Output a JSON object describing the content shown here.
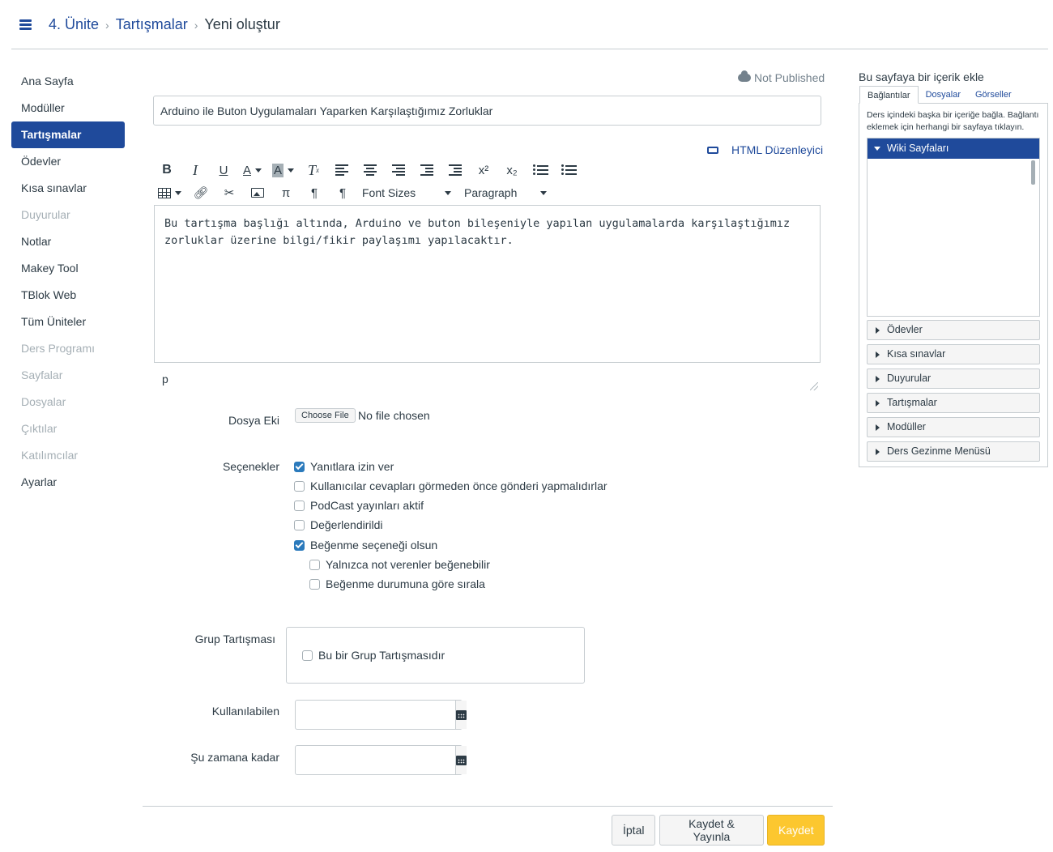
{
  "breadcrumb": {
    "items": [
      "4. Ünite",
      "Tartışmalar"
    ],
    "current": "Yeni oluştur"
  },
  "nav": {
    "items": [
      {
        "label": "Ana Sayfa",
        "state": "normal"
      },
      {
        "label": "Modüller",
        "state": "normal"
      },
      {
        "label": "Tartışmalar",
        "state": "active"
      },
      {
        "label": "Ödevler",
        "state": "normal"
      },
      {
        "label": "Kısa sınavlar",
        "state": "normal"
      },
      {
        "label": "Duyurular",
        "state": "disabled"
      },
      {
        "label": "Notlar",
        "state": "normal"
      },
      {
        "label": "Makey Tool",
        "state": "normal"
      },
      {
        "label": "TBlok Web",
        "state": "normal"
      },
      {
        "label": "Tüm Üniteler",
        "state": "normal"
      },
      {
        "label": "Ders Programı",
        "state": "disabled"
      },
      {
        "label": "Sayfalar",
        "state": "disabled"
      },
      {
        "label": "Dosyalar",
        "state": "disabled"
      },
      {
        "label": "Çıktılar",
        "state": "disabled"
      },
      {
        "label": "Katılımcılar",
        "state": "disabled"
      },
      {
        "label": "Ayarlar",
        "state": "normal"
      }
    ]
  },
  "form": {
    "status": "Not Published",
    "title_value": "Arduino ile Buton Uygulamaları Yaparken Karşılaştığımız Zorluklar",
    "html_editor_link": "HTML Düzenleyici",
    "toolbar": {
      "font_sizes": "Font Sizes",
      "paragraph": "Paragraph",
      "pi": "π",
      "superscript": "x²",
      "subscript": "x₂"
    },
    "body_text": "Bu tartışma başlığı altında, Arduino ve buton bileşeniyle yapılan uygulamalarda karşılaştığımız zorluklar üzerine bilgi/fikir paylaşımı yapılacaktır.",
    "path": "p",
    "attachment_label": "Dosya Eki",
    "choose_file": "Choose File",
    "no_file": "No file chosen",
    "options_label": "Seçenekler",
    "options": [
      {
        "label": "Yanıtlara izin ver",
        "checked": true
      },
      {
        "label": "Kullanıcılar cevapları görmeden önce gönderi yapmalıdırlar",
        "checked": false
      },
      {
        "label": "PodCast yayınları aktif",
        "checked": false
      },
      {
        "label": "Değerlendirildi",
        "checked": false
      },
      {
        "label": "Beğenme seçeneği olsun",
        "checked": true
      },
      {
        "label": "Yalnızca not verenler beğenebilir",
        "checked": false
      },
      {
        "label": "Beğenme durumuna göre sırala",
        "checked": false
      }
    ],
    "group_label": "Grup Tartışması",
    "group_checkbox": "Bu bir Grup Tartışmasıdır",
    "available_label": "Kullanılabilen",
    "until_label": "Şu zamana kadar",
    "available_value": "",
    "until_value": ""
  },
  "buttons": {
    "cancel": "İptal",
    "save_publish": "Kaydet & Yayınla",
    "save": "Kaydet"
  },
  "sidebar": {
    "title": "Bu sayfaya bir içerik ekle",
    "tabs": [
      "Bağlantılar",
      "Dosyalar",
      "Görseller"
    ],
    "help": "Ders içindeki başka bir içeriğe bağla. Bağlantı eklemek için herhangi bir sayfaya tıklayın.",
    "open_section": "Wiki Sayfaları",
    "sections": [
      "Ödevler",
      "Kısa sınavlar",
      "Duyurular",
      "Tartışmalar",
      "Modüller",
      "Ders Gezinme Menüsü"
    ]
  },
  "colors": {
    "brand": "#1f4a9b",
    "save_button": "#fcc72f",
    "checkbox_checked": "#2b7abc",
    "disabled_text": "#a5afb5"
  }
}
